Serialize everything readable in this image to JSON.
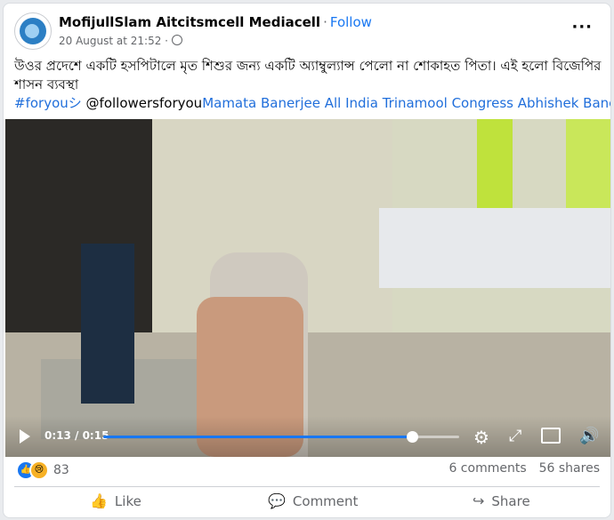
{
  "post": {
    "author": "MofijullSlam Aitcitsmcell Mediacell",
    "follow_label": "Follow",
    "timestamp": "20 August at 21:52",
    "privacy_icon": "globe-icon",
    "more_icon": "more-options-icon",
    "text": "উওর প্রদেশে একটি হসপিটালে মৃত শিশুর জন্য একটি অ্যাম্বুল্যান্স পেলো না শোকাহত পিতা। এই হলো বিজেপির শাসন ব্যবস্থা",
    "hashtag": "#foryouシ",
    "mention": "@followersforyou",
    "tags": "Mamata Banerjee All India Trinamool Congress Abhishek Banerjee"
  },
  "video": {
    "time_display": "0:13 / 0:15",
    "progress_fraction": 0.8667,
    "icons": [
      "play-icon",
      "settings-icon",
      "expand-icon",
      "pip-icon",
      "volume-icon"
    ]
  },
  "engagement": {
    "reaction_count": "83",
    "comments": "6 comments",
    "shares": "56 shares"
  },
  "actions": {
    "like": "Like",
    "comment": "Comment",
    "share": "Share"
  },
  "colors": {
    "accent": "#1877f2",
    "link": "#216fdb"
  }
}
